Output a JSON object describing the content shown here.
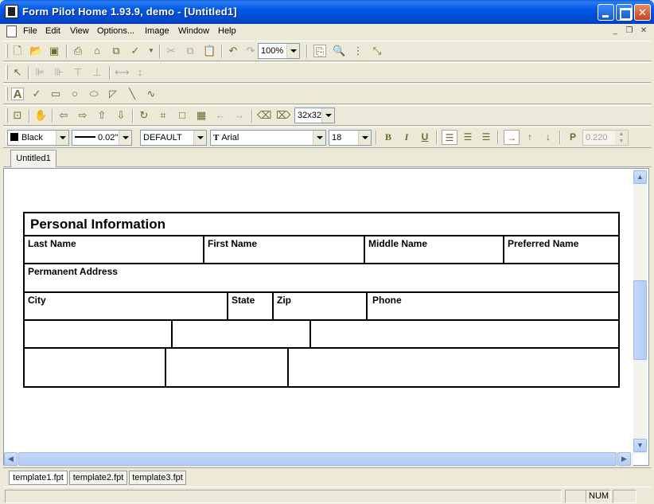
{
  "window": {
    "title": "Form Pilot Home 1.93.9, demo - [Untitled1]"
  },
  "menu": {
    "items": [
      "File",
      "Edit",
      "View",
      "Options...",
      "Image",
      "Window",
      "Help"
    ]
  },
  "toolbar_main": {
    "zoom": "100%"
  },
  "toolbar_image": {
    "cell_size": "32x32"
  },
  "format_bar": {
    "color": "Black",
    "line_width": "0.02\"",
    "style": "DEFAULT",
    "font": "Arial",
    "font_size": "18",
    "bold": "B",
    "italic": "I",
    "underline": "U",
    "paragraph": "P",
    "spacing": "0.220"
  },
  "document_tabs": [
    "Untitled1"
  ],
  "form": {
    "title": "Personal Information",
    "labels": {
      "last_name": "Last Name",
      "first_name": "First Name",
      "middle_name": "Middle Name",
      "preferred_name": "Preferred Name",
      "permanent_address": "Permanent Address",
      "city": "City",
      "state": "State",
      "zip": "Zip",
      "phone": "Phone"
    }
  },
  "template_tabs": [
    "template1.fpt",
    "template2.fpt",
    "template3.fpt"
  ],
  "status": {
    "num": "NUM"
  }
}
